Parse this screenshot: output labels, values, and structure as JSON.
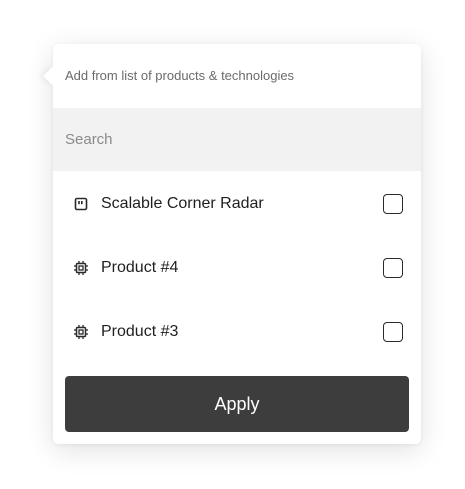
{
  "popover": {
    "header": "Add from list of products & technologies",
    "search": {
      "placeholder": "Search",
      "value": ""
    },
    "items": [
      {
        "label": "Scalable Corner Radar",
        "icon": "radar-module-icon",
        "checked": false
      },
      {
        "label": "Product #4",
        "icon": "chip-icon",
        "checked": false
      },
      {
        "label": "Product #3",
        "icon": "chip-icon",
        "checked": false
      }
    ],
    "apply_label": "Apply"
  },
  "colors": {
    "search_background": "#f2f2f2",
    "apply_background": "#3d3d3d",
    "apply_text": "#ffffff",
    "header_text": "#6b6b6b"
  }
}
